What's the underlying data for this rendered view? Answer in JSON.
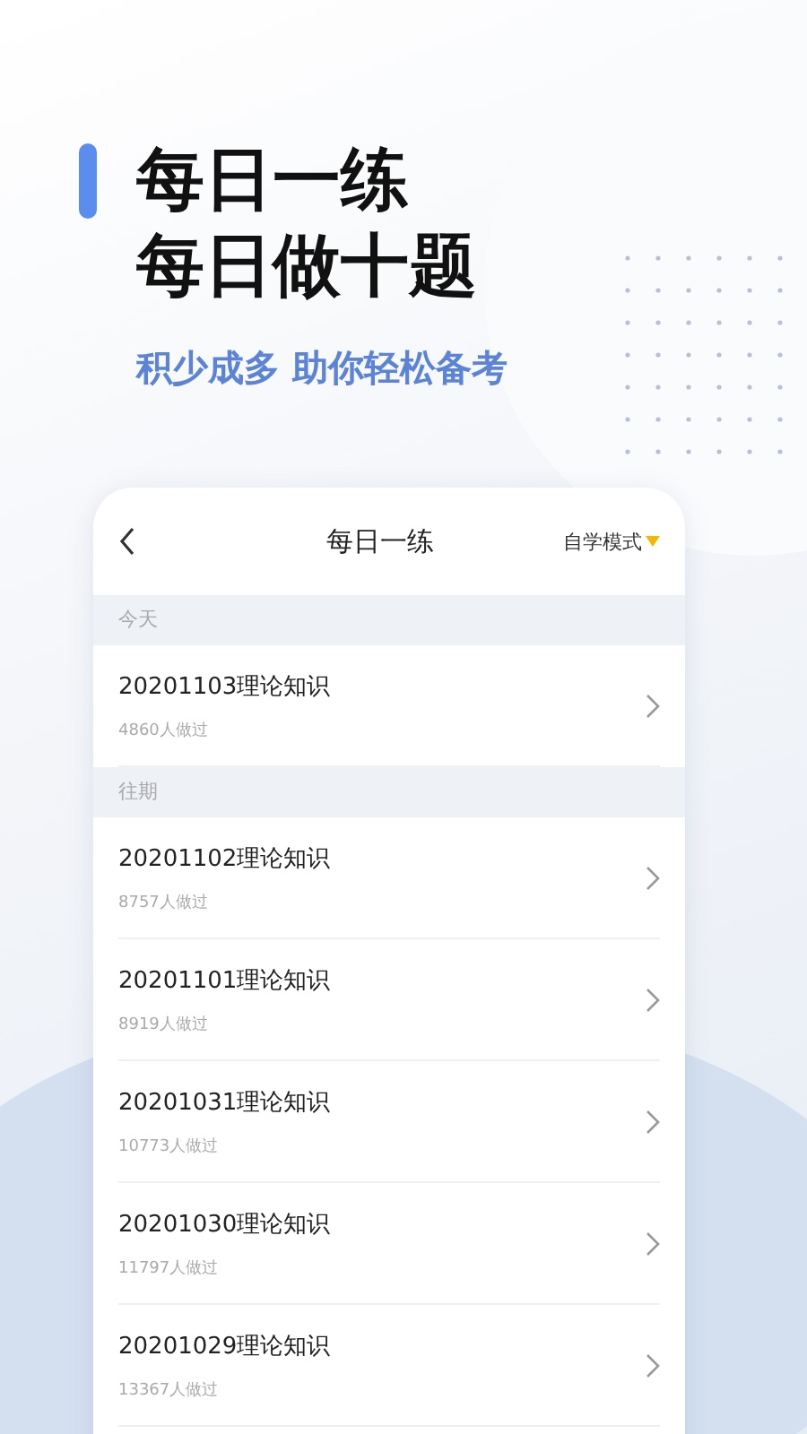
{
  "headline": {
    "lines": [
      "每日一练",
      "每日做十题"
    ],
    "subtitle": "积少成多 助你轻松备考"
  },
  "phone": {
    "title": "每日一练",
    "mode": "自学模式",
    "sections": [
      {
        "label": "今天",
        "items": [
          {
            "title": "20201103理论知识",
            "count": "4860人做过"
          }
        ]
      },
      {
        "label": "往期",
        "items": [
          {
            "title": "20201102理论知识",
            "count": "8757人做过"
          },
          {
            "title": "20201101理论知识",
            "count": "8919人做过"
          },
          {
            "title": "20201031理论知识",
            "count": "10773人做过"
          },
          {
            "title": "20201030理论知识",
            "count": "11797人做过"
          },
          {
            "title": "20201029理论知识",
            "count": "13367人做过"
          }
        ]
      }
    ]
  }
}
